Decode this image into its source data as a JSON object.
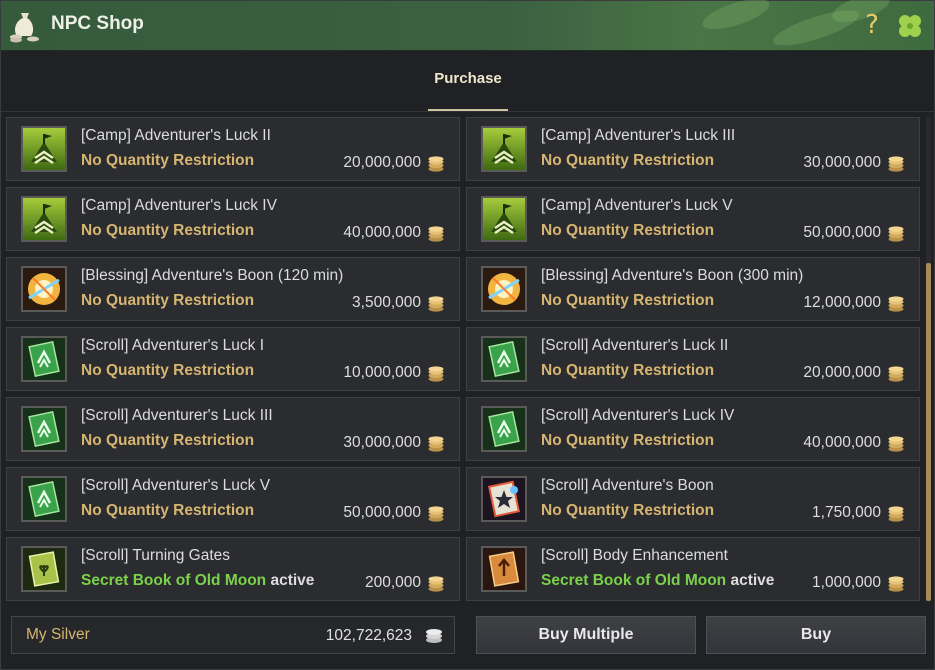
{
  "window": {
    "title": "NPC Shop"
  },
  "tabs": [
    {
      "label": "Purchase",
      "selected": true
    }
  ],
  "colors": {
    "accent_gold": "#d6b570",
    "status_green": "#7bd14a",
    "title_bar_green": "#3b6141",
    "scroll_thumb": "#a98b5a"
  },
  "items": [
    {
      "name": "[Camp] Adventurer's Luck II",
      "restriction": "No Quantity Restriction",
      "price": "20,000,000",
      "icon": "camp-icon"
    },
    {
      "name": "[Camp] Adventurer's Luck III",
      "restriction": "No Quantity Restriction",
      "price": "30,000,000",
      "icon": "camp-icon"
    },
    {
      "name": "[Camp] Adventurer's Luck IV",
      "restriction": "No Quantity Restriction",
      "price": "40,000,000",
      "icon": "camp-icon"
    },
    {
      "name": "[Camp] Adventurer's Luck V",
      "restriction": "No Quantity Restriction",
      "price": "50,000,000",
      "icon": "camp-icon"
    },
    {
      "name": "[Blessing] Adventure's Boon (120 min)",
      "restriction": "No Quantity Restriction",
      "price": "3,500,000",
      "icon": "blessing-icon"
    },
    {
      "name": "[Blessing] Adventure's Boon (300 min)",
      "restriction": "No Quantity Restriction",
      "price": "12,000,000",
      "icon": "blessing-icon"
    },
    {
      "name": "[Scroll] Adventurer's Luck I",
      "restriction": "No Quantity Restriction",
      "price": "10,000,000",
      "icon": "green-scroll-icon"
    },
    {
      "name": "[Scroll] Adventurer's Luck II",
      "restriction": "No Quantity Restriction",
      "price": "20,000,000",
      "icon": "green-scroll-icon"
    },
    {
      "name": "[Scroll] Adventurer's Luck III",
      "restriction": "No Quantity Restriction",
      "price": "30,000,000",
      "icon": "green-scroll-icon"
    },
    {
      "name": "[Scroll] Adventurer's Luck IV",
      "restriction": "No Quantity Restriction",
      "price": "40,000,000",
      "icon": "green-scroll-icon"
    },
    {
      "name": "[Scroll] Adventurer's Luck V",
      "restriction": "No Quantity Restriction",
      "price": "50,000,000",
      "icon": "green-scroll-icon"
    },
    {
      "name": "[Scroll] Adventure's Boon",
      "restriction": "No Quantity Restriction",
      "price": "1,750,000",
      "icon": "star-scroll-icon"
    },
    {
      "name": "[Scroll] Turning Gates",
      "restriction": "Secret Book of Old Moon",
      "restriction_suffix": "active",
      "price": "200,000",
      "icon": "turning-gates-scroll-icon"
    },
    {
      "name": "[Scroll] Body Enhancement",
      "restriction": "Secret Book of Old Moon",
      "restriction_suffix": "active",
      "price": "1,000,000",
      "icon": "body-enhancement-scroll-icon"
    }
  ],
  "footer": {
    "silver_label": "My Silver",
    "silver_value": "102,722,623",
    "buy_multiple_label": "Buy Multiple",
    "buy_label": "Buy"
  }
}
